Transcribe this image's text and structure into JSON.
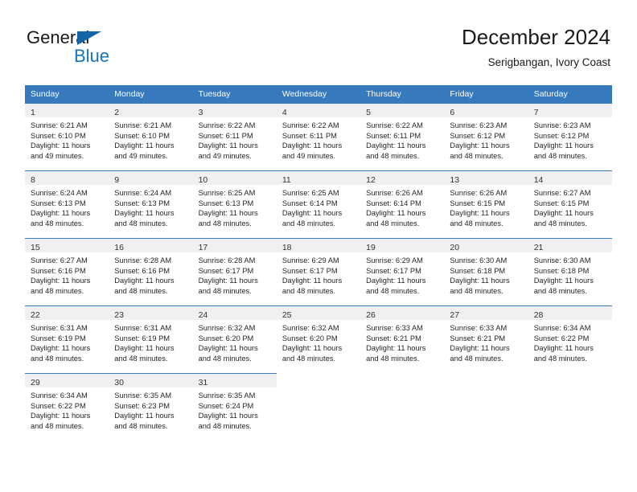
{
  "brand": {
    "name_top": "General",
    "name_bottom": "Blue",
    "triangle_color": "#1464aa",
    "blue_color": "#1673be"
  },
  "header": {
    "month_title": "December 2024",
    "location": "Serigbangan, Ivory Coast"
  },
  "theme": {
    "header_row_bg": "#3679bc",
    "daynum_band_bg": "#f0f0f0",
    "text_color": "#262626"
  },
  "weekdays": [
    "Sunday",
    "Monday",
    "Tuesday",
    "Wednesday",
    "Thursday",
    "Friday",
    "Saturday"
  ],
  "weeks": [
    [
      {
        "day": "1",
        "sunrise": "Sunrise: 6:21 AM",
        "sunset": "Sunset: 6:10 PM",
        "daylight1": "Daylight: 11 hours",
        "daylight2": "and 49 minutes."
      },
      {
        "day": "2",
        "sunrise": "Sunrise: 6:21 AM",
        "sunset": "Sunset: 6:10 PM",
        "daylight1": "Daylight: 11 hours",
        "daylight2": "and 49 minutes."
      },
      {
        "day": "3",
        "sunrise": "Sunrise: 6:22 AM",
        "sunset": "Sunset: 6:11 PM",
        "daylight1": "Daylight: 11 hours",
        "daylight2": "and 49 minutes."
      },
      {
        "day": "4",
        "sunrise": "Sunrise: 6:22 AM",
        "sunset": "Sunset: 6:11 PM",
        "daylight1": "Daylight: 11 hours",
        "daylight2": "and 49 minutes."
      },
      {
        "day": "5",
        "sunrise": "Sunrise: 6:22 AM",
        "sunset": "Sunset: 6:11 PM",
        "daylight1": "Daylight: 11 hours",
        "daylight2": "and 48 minutes."
      },
      {
        "day": "6",
        "sunrise": "Sunrise: 6:23 AM",
        "sunset": "Sunset: 6:12 PM",
        "daylight1": "Daylight: 11 hours",
        "daylight2": "and 48 minutes."
      },
      {
        "day": "7",
        "sunrise": "Sunrise: 6:23 AM",
        "sunset": "Sunset: 6:12 PM",
        "daylight1": "Daylight: 11 hours",
        "daylight2": "and 48 minutes."
      }
    ],
    [
      {
        "day": "8",
        "sunrise": "Sunrise: 6:24 AM",
        "sunset": "Sunset: 6:13 PM",
        "daylight1": "Daylight: 11 hours",
        "daylight2": "and 48 minutes."
      },
      {
        "day": "9",
        "sunrise": "Sunrise: 6:24 AM",
        "sunset": "Sunset: 6:13 PM",
        "daylight1": "Daylight: 11 hours",
        "daylight2": "and 48 minutes."
      },
      {
        "day": "10",
        "sunrise": "Sunrise: 6:25 AM",
        "sunset": "Sunset: 6:13 PM",
        "daylight1": "Daylight: 11 hours",
        "daylight2": "and 48 minutes."
      },
      {
        "day": "11",
        "sunrise": "Sunrise: 6:25 AM",
        "sunset": "Sunset: 6:14 PM",
        "daylight1": "Daylight: 11 hours",
        "daylight2": "and 48 minutes."
      },
      {
        "day": "12",
        "sunrise": "Sunrise: 6:26 AM",
        "sunset": "Sunset: 6:14 PM",
        "daylight1": "Daylight: 11 hours",
        "daylight2": "and 48 minutes."
      },
      {
        "day": "13",
        "sunrise": "Sunrise: 6:26 AM",
        "sunset": "Sunset: 6:15 PM",
        "daylight1": "Daylight: 11 hours",
        "daylight2": "and 48 minutes."
      },
      {
        "day": "14",
        "sunrise": "Sunrise: 6:27 AM",
        "sunset": "Sunset: 6:15 PM",
        "daylight1": "Daylight: 11 hours",
        "daylight2": "and 48 minutes."
      }
    ],
    [
      {
        "day": "15",
        "sunrise": "Sunrise: 6:27 AM",
        "sunset": "Sunset: 6:16 PM",
        "daylight1": "Daylight: 11 hours",
        "daylight2": "and 48 minutes."
      },
      {
        "day": "16",
        "sunrise": "Sunrise: 6:28 AM",
        "sunset": "Sunset: 6:16 PM",
        "daylight1": "Daylight: 11 hours",
        "daylight2": "and 48 minutes."
      },
      {
        "day": "17",
        "sunrise": "Sunrise: 6:28 AM",
        "sunset": "Sunset: 6:17 PM",
        "daylight1": "Daylight: 11 hours",
        "daylight2": "and 48 minutes."
      },
      {
        "day": "18",
        "sunrise": "Sunrise: 6:29 AM",
        "sunset": "Sunset: 6:17 PM",
        "daylight1": "Daylight: 11 hours",
        "daylight2": "and 48 minutes."
      },
      {
        "day": "19",
        "sunrise": "Sunrise: 6:29 AM",
        "sunset": "Sunset: 6:17 PM",
        "daylight1": "Daylight: 11 hours",
        "daylight2": "and 48 minutes."
      },
      {
        "day": "20",
        "sunrise": "Sunrise: 6:30 AM",
        "sunset": "Sunset: 6:18 PM",
        "daylight1": "Daylight: 11 hours",
        "daylight2": "and 48 minutes."
      },
      {
        "day": "21",
        "sunrise": "Sunrise: 6:30 AM",
        "sunset": "Sunset: 6:18 PM",
        "daylight1": "Daylight: 11 hours",
        "daylight2": "and 48 minutes."
      }
    ],
    [
      {
        "day": "22",
        "sunrise": "Sunrise: 6:31 AM",
        "sunset": "Sunset: 6:19 PM",
        "daylight1": "Daylight: 11 hours",
        "daylight2": "and 48 minutes."
      },
      {
        "day": "23",
        "sunrise": "Sunrise: 6:31 AM",
        "sunset": "Sunset: 6:19 PM",
        "daylight1": "Daylight: 11 hours",
        "daylight2": "and 48 minutes."
      },
      {
        "day": "24",
        "sunrise": "Sunrise: 6:32 AM",
        "sunset": "Sunset: 6:20 PM",
        "daylight1": "Daylight: 11 hours",
        "daylight2": "and 48 minutes."
      },
      {
        "day": "25",
        "sunrise": "Sunrise: 6:32 AM",
        "sunset": "Sunset: 6:20 PM",
        "daylight1": "Daylight: 11 hours",
        "daylight2": "and 48 minutes."
      },
      {
        "day": "26",
        "sunrise": "Sunrise: 6:33 AM",
        "sunset": "Sunset: 6:21 PM",
        "daylight1": "Daylight: 11 hours",
        "daylight2": "and 48 minutes."
      },
      {
        "day": "27",
        "sunrise": "Sunrise: 6:33 AM",
        "sunset": "Sunset: 6:21 PM",
        "daylight1": "Daylight: 11 hours",
        "daylight2": "and 48 minutes."
      },
      {
        "day": "28",
        "sunrise": "Sunrise: 6:34 AM",
        "sunset": "Sunset: 6:22 PM",
        "daylight1": "Daylight: 11 hours",
        "daylight2": "and 48 minutes."
      }
    ],
    [
      {
        "day": "29",
        "sunrise": "Sunrise: 6:34 AM",
        "sunset": "Sunset: 6:22 PM",
        "daylight1": "Daylight: 11 hours",
        "daylight2": "and 48 minutes."
      },
      {
        "day": "30",
        "sunrise": "Sunrise: 6:35 AM",
        "sunset": "Sunset: 6:23 PM",
        "daylight1": "Daylight: 11 hours",
        "daylight2": "and 48 minutes."
      },
      {
        "day": "31",
        "sunrise": "Sunrise: 6:35 AM",
        "sunset": "Sunset: 6:24 PM",
        "daylight1": "Daylight: 11 hours",
        "daylight2": "and 48 minutes."
      },
      {
        "day": "",
        "sunrise": "",
        "sunset": "",
        "daylight1": "",
        "daylight2": ""
      },
      {
        "day": "",
        "sunrise": "",
        "sunset": "",
        "daylight1": "",
        "daylight2": ""
      },
      {
        "day": "",
        "sunrise": "",
        "sunset": "",
        "daylight1": "",
        "daylight2": ""
      },
      {
        "day": "",
        "sunrise": "",
        "sunset": "",
        "daylight1": "",
        "daylight2": ""
      }
    ]
  ]
}
